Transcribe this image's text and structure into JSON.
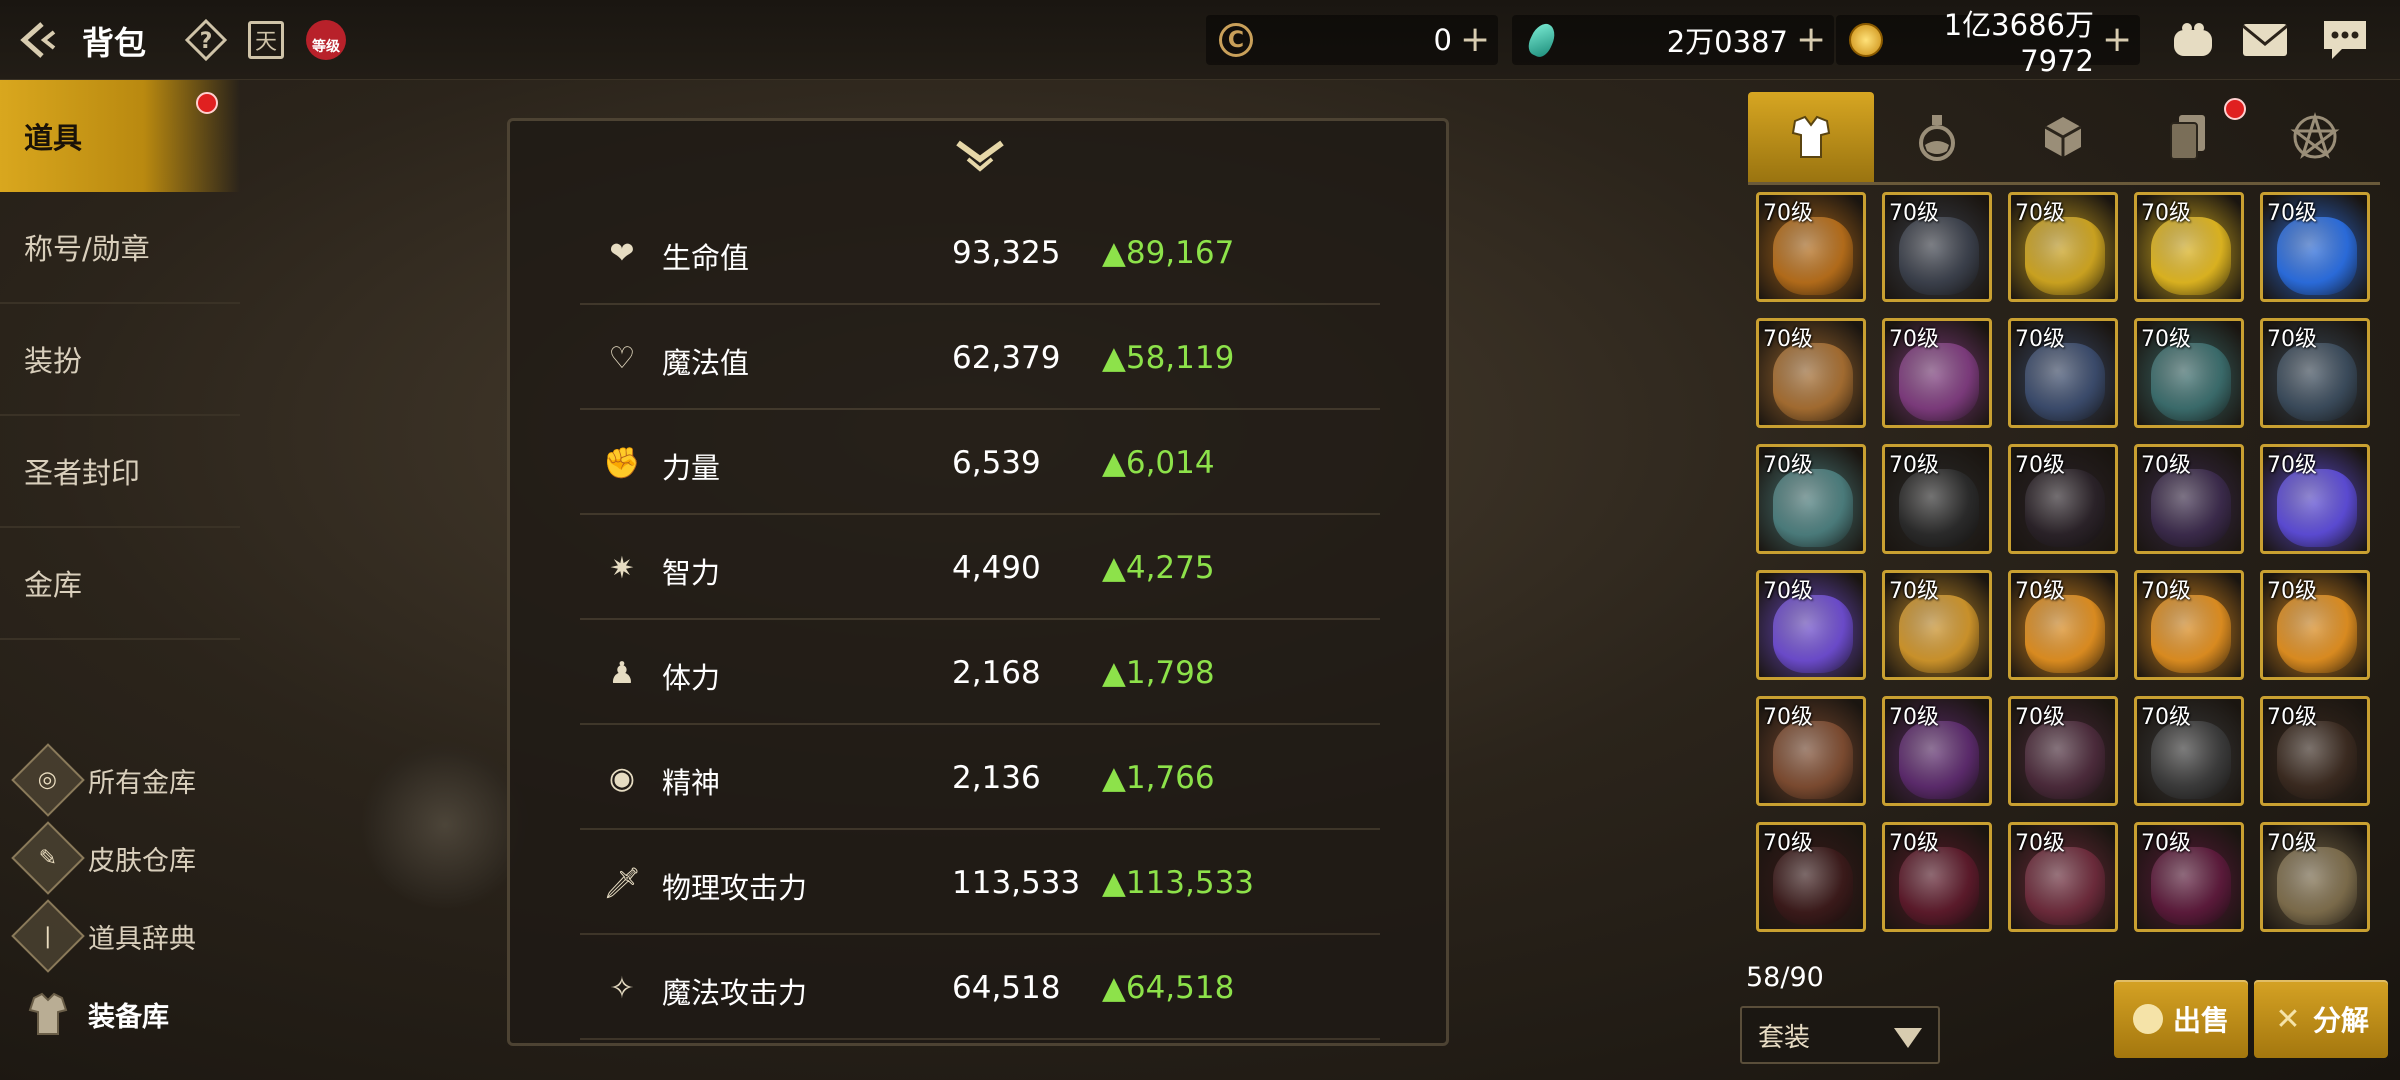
{
  "header": {
    "title": "背包",
    "calendar_label": "天",
    "level_badge": "等级"
  },
  "currencies": [
    {
      "icon": "crescent-coin-icon",
      "value": "0"
    },
    {
      "icon": "gem-icon",
      "value": "2万0387"
    },
    {
      "icon": "gold-coin-icon",
      "value": "1亿3686万7972"
    }
  ],
  "sidebar": {
    "items": [
      {
        "label": "道具"
      },
      {
        "label": "称号/勋章"
      },
      {
        "label": "装扮"
      },
      {
        "label": "圣者封印"
      },
      {
        "label": "金库"
      }
    ],
    "bottom_items": [
      {
        "label": "所有金库",
        "icon": "vault-icon"
      },
      {
        "label": "皮肤仓库",
        "icon": "brush-icon"
      },
      {
        "label": "道具辞典",
        "icon": "book-icon"
      },
      {
        "label": "装备库",
        "icon": "armor-icon"
      }
    ]
  },
  "stats": [
    {
      "name": "生命值",
      "value": "93,325",
      "increase": "▲89,167",
      "icon": "heart-icon"
    },
    {
      "name": "魔法值",
      "value": "62,379",
      "increase": "▲58,119",
      "icon": "heart-outline-icon"
    },
    {
      "name": "力量",
      "value": "6,539",
      "increase": "▲6,014",
      "icon": "fist-icon"
    },
    {
      "name": "智力",
      "value": "4,490",
      "increase": "▲4,275",
      "icon": "spark-icon"
    },
    {
      "name": "体力",
      "value": "2,168",
      "increase": "▲1,798",
      "icon": "body-icon"
    },
    {
      "name": "精神",
      "value": "2,136",
      "increase": "▲1,766",
      "icon": "spirit-icon"
    },
    {
      "name": "物理攻击力",
      "value": "113,533",
      "increase": "▲113,533",
      "icon": "sword-icon"
    },
    {
      "name": "魔法攻击力",
      "value": "64,518",
      "increase": "▲64,518",
      "icon": "magic-star-icon"
    }
  ],
  "inventory": {
    "tabs": [
      "armor-tab-icon",
      "potion-tab-icon",
      "material-tab-icon",
      "cards-tab-icon",
      "pentagram-tab-icon"
    ],
    "level_label": "70级",
    "count": "58/90",
    "filter": "套装",
    "sell_label": "出售",
    "decompose_label": "分解",
    "slot_colors": [
      [
        "#b06a1a",
        "#3a3f4a",
        "#c8a020",
        "#d8b020",
        "#2a6ad8"
      ],
      [
        "#a06a30",
        "#7a3a7a",
        "#3a4a6a",
        "#3a6a6a",
        "#3a4a5a"
      ],
      [
        "#4a7a7a",
        "#2a2a2a",
        "#2a2228",
        "#3a2a4a",
        "#5a4ad0"
      ],
      [
        "#6a4ac8",
        "#c8902a",
        "#d88a20",
        "#d88a20",
        "#d88a20"
      ],
      [
        "#7a4a30",
        "#5a2a6a",
        "#4a2a3a",
        "#3a3a3a",
        "#3a2a20"
      ],
      [
        "#3a1a1a",
        "#5a1a2a",
        "#6a2a3a",
        "#5a1a3a",
        "#7a6a4a"
      ]
    ]
  },
  "colors": {
    "accent_gold": "#d7a622",
    "increase_green": "#8de24a",
    "notification_red": "#e02020"
  }
}
